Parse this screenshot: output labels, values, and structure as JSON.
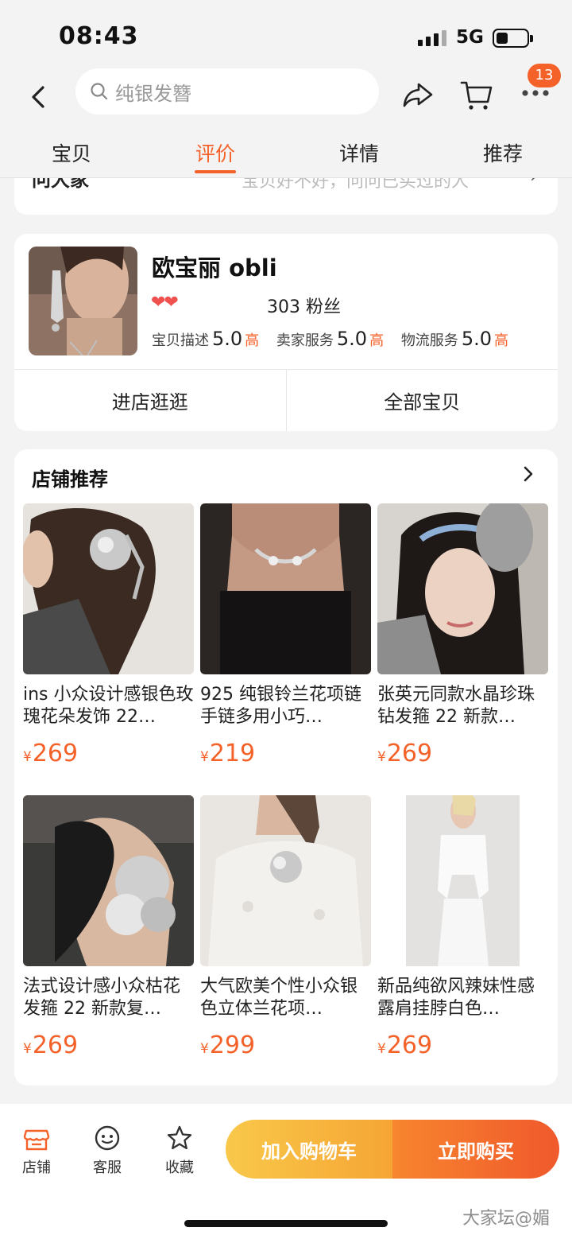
{
  "status_bar": {
    "time": "08:43",
    "network": "5G"
  },
  "header": {
    "search_placeholder": "纯银发簪",
    "cart_badge": "13",
    "tabs": [
      {
        "label": "宝贝",
        "active": false
      },
      {
        "label": "评价",
        "active": true
      },
      {
        "label": "详情",
        "active": false
      },
      {
        "label": "推荐",
        "active": false
      }
    ]
  },
  "peek_card": {
    "left_text": "问大家",
    "right_text": "宝贝好不好，问问已买过的人"
  },
  "shop": {
    "name": "欧宝丽 obli",
    "hearts": "❤❤",
    "fans": "303 粉丝",
    "ratings": [
      {
        "label": "宝贝描述",
        "score": "5.0",
        "level": "高"
      },
      {
        "label": "卖家服务",
        "score": "5.0",
        "level": "高"
      },
      {
        "label": "物流服务",
        "score": "5.0",
        "level": "高"
      }
    ],
    "enter_shop": "进店逛逛",
    "all_items": "全部宝贝"
  },
  "recommend": {
    "title": "店铺推荐",
    "currency": "¥",
    "items": [
      {
        "name": "ins 小众设计感银色玫瑰花朵发饰 22…",
        "price": "269"
      },
      {
        "name": "925 纯银铃兰花项链手链多用小巧…",
        "price": "219"
      },
      {
        "name": "张英元同款水晶珍珠钻发箍 22 新款…",
        "price": "269"
      },
      {
        "name": "法式设计感小众枯花发箍 22 新款复…",
        "price": "269"
      },
      {
        "name": "大气欧美个性小众银色立体兰花项…",
        "price": "299"
      },
      {
        "name": "新品纯欲风辣妹性感露肩挂脖白色…",
        "price": "269"
      }
    ]
  },
  "bottom_bar": {
    "nav": [
      {
        "label": "店铺",
        "icon": "shop-icon"
      },
      {
        "label": "客服",
        "icon": "service-icon"
      },
      {
        "label": "收藏",
        "icon": "star-icon"
      }
    ],
    "add_to_cart": "加入购物车",
    "buy_now": "立即购买"
  },
  "watermark": "大家坛@媚",
  "colors": {
    "accent": "#f4622a",
    "cart_button": "#f6b43e",
    "buy_button": "#f26a2c"
  }
}
